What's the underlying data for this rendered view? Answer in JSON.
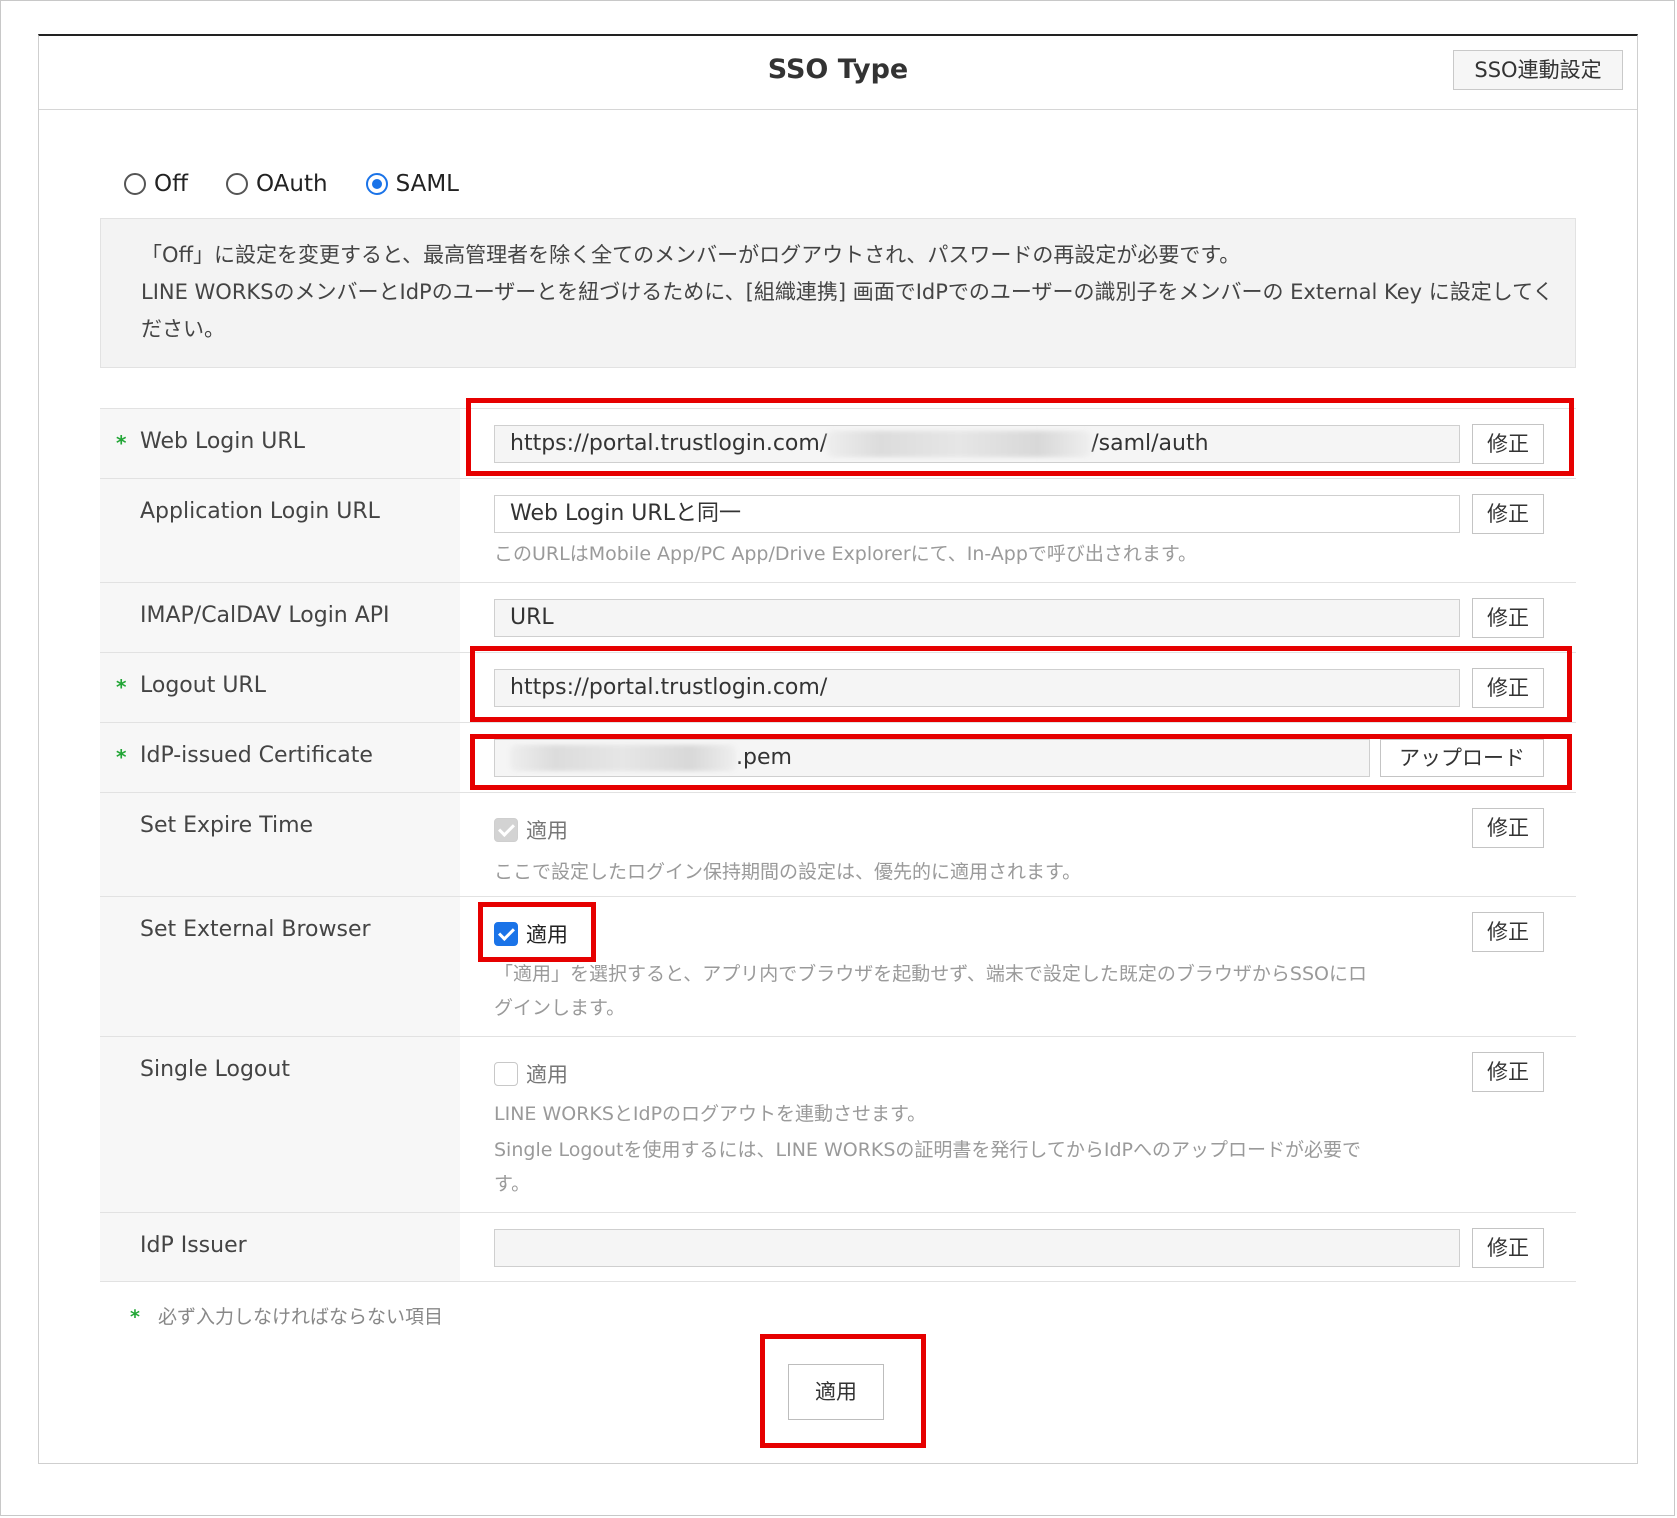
{
  "header": {
    "title": "SSO Type",
    "link_button": "SSO連動設定"
  },
  "sso_type": {
    "options": [
      "Off",
      "OAuth",
      "SAML"
    ],
    "selected": "SAML"
  },
  "notice": {
    "line1": "「Off」に設定を変更すると、最高管理者を除く全てのメンバーがログアウトされ、パスワードの再設定が必要です。",
    "line2": "LINE WORKSのメンバーとIdPのユーザーとを紐づけるために、[組織連携] 画面でIdPでのユーザーの識別子をメンバーの External Key に設定してください。"
  },
  "fields": {
    "web_login_url": {
      "label": "Web Login URL",
      "required": "*",
      "value_prefix": "https://portal.trustlogin.com/",
      "value_suffix": "/saml/auth",
      "button": "修正"
    },
    "application_login_url": {
      "label": "Application Login URL",
      "value": "Web Login URLと同一",
      "help": "このURLはMobile App/PC App/Drive Explorerにて、In-Appで呼び出されます。",
      "button": "修正"
    },
    "imap_login_api": {
      "label": "IMAP/CalDAV Login API",
      "value": "URL",
      "button": "修正"
    },
    "logout_url": {
      "label": "Logout URL",
      "required": "*",
      "value": "https://portal.trustlogin.com/",
      "button": "修正"
    },
    "idp_certificate": {
      "label": "IdP-issued Certificate",
      "required": "*",
      "value_suffix": ".pem",
      "button": "アップロード"
    },
    "set_expire_time": {
      "label": "Set Expire Time",
      "check_label": "適用",
      "checked": true,
      "disabled": true,
      "help": "ここで設定したログイン保持期間の設定は、優先的に適用されます。",
      "button": "修正"
    },
    "set_external_browser": {
      "label": "Set External Browser",
      "check_label": "適用",
      "checked": true,
      "help_line1": "「適用」を選択すると、アプリ内でブラウザを起動せず、端末で設定した既定のブラウザからSSOにロ",
      "help_line2": "グインします。",
      "button": "修正"
    },
    "single_logout": {
      "label": "Single Logout",
      "check_label": "適用",
      "checked": false,
      "help_line1": "LINE WORKSとIdPのログアウトを連動させます。",
      "help_line2": "Single Logoutを使用するには、LINE WORKSの証明書を発行してからIdPへのアップロードが必要で",
      "help_line3": "す。",
      "button": "修正"
    },
    "idp_issuer": {
      "label": "IdP Issuer",
      "value": "",
      "button": "修正"
    }
  },
  "footer": {
    "required_mark": "*",
    "required_note": "必ず入力しなければならない項目",
    "apply_button": "適用"
  },
  "colors": {
    "highlight": "#e60000",
    "accent": "#1a73e8",
    "required": "#22a636"
  }
}
